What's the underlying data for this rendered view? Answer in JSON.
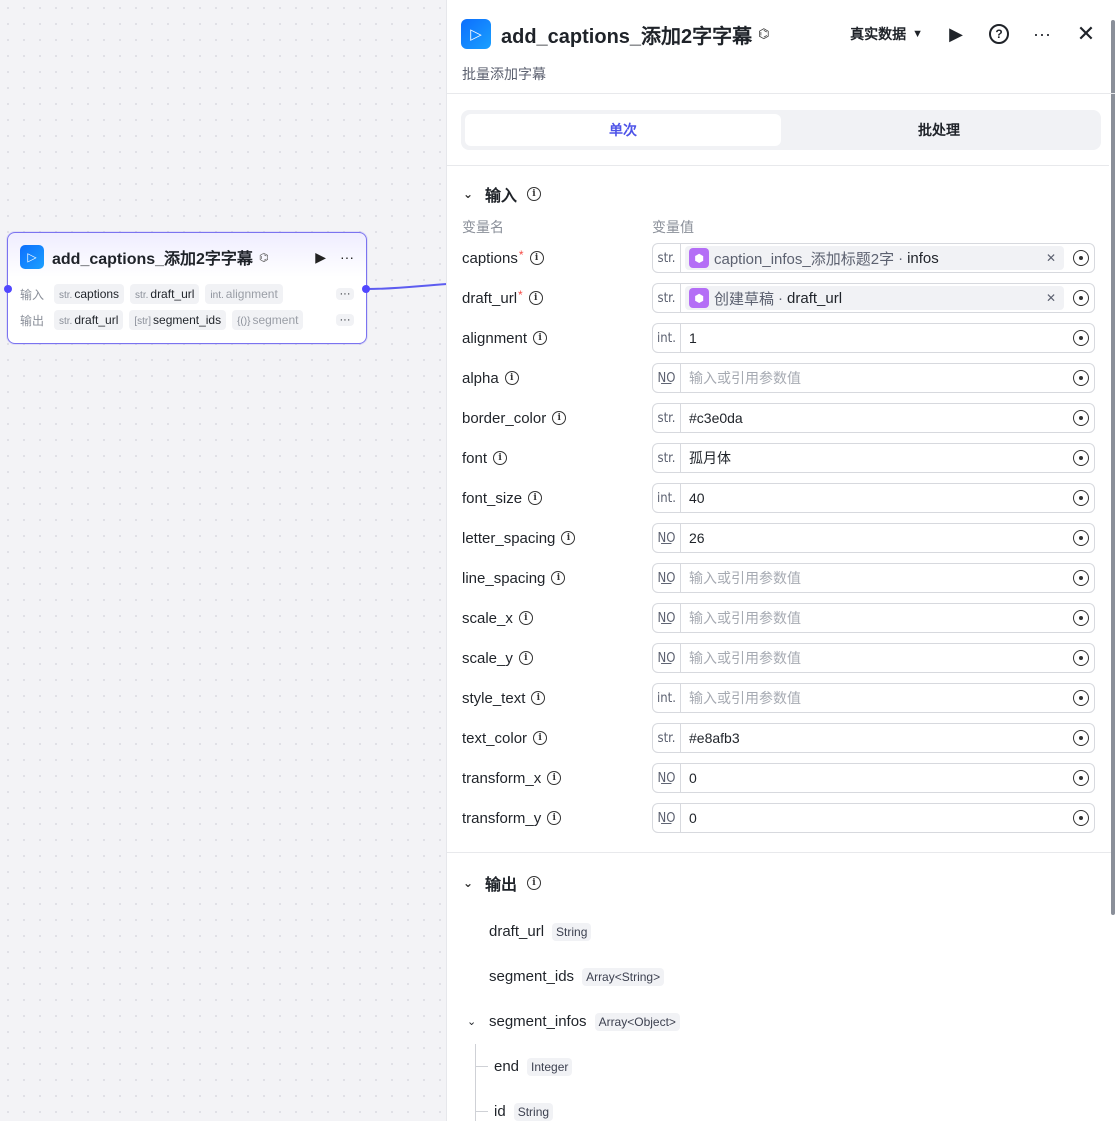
{
  "node": {
    "title": "add_captions_添加2字字幕",
    "input_label": "输入",
    "output_label": "输出",
    "inputs": [
      {
        "type": "str.",
        "name": "captions"
      },
      {
        "type": "str.",
        "name": "draft_url"
      },
      {
        "type": "int.",
        "name": "alignment"
      }
    ],
    "outputs": [
      {
        "type": "str.",
        "name": "draft_url"
      },
      {
        "type": "[str]",
        "name": "segment_ids"
      },
      {
        "type": "{()}",
        "name": "segment"
      }
    ],
    "more": "···"
  },
  "panel": {
    "title": "add_captions_添加2字字幕",
    "description": "批量添加字幕",
    "data_mode": "真实数据",
    "tabs": [
      "单次",
      "批处理"
    ],
    "input_section": "输入",
    "col_name": "变量名",
    "col_value": "变量值",
    "params": [
      {
        "name": "captions",
        "required": true,
        "type": "str.",
        "ref_source": "caption_infos_添加标题2字",
        "ref_field": "infos"
      },
      {
        "name": "draft_url",
        "required": true,
        "type": "str.",
        "ref_source": "创建草稿",
        "ref_field": "draft_url"
      },
      {
        "name": "alignment",
        "type": "int.",
        "value": "1"
      },
      {
        "name": "alpha",
        "type": "N͟O",
        "placeholder": "输入或引用参数值"
      },
      {
        "name": "border_color",
        "type": "str.",
        "value": "#c3e0da"
      },
      {
        "name": "font",
        "type": "str.",
        "value": "孤月体"
      },
      {
        "name": "font_size",
        "type": "int.",
        "value": "40"
      },
      {
        "name": "letter_spacing",
        "type": "N͟O",
        "value": "26"
      },
      {
        "name": "line_spacing",
        "type": "N͟O",
        "placeholder": "输入或引用参数值"
      },
      {
        "name": "scale_x",
        "type": "N͟O",
        "placeholder": "输入或引用参数值"
      },
      {
        "name": "scale_y",
        "type": "N͟O",
        "placeholder": "输入或引用参数值"
      },
      {
        "name": "style_text",
        "type": "int.",
        "placeholder": "输入或引用参数值"
      },
      {
        "name": "text_color",
        "type": "str.",
        "value": "#e8afb3"
      },
      {
        "name": "transform_x",
        "type": "N͟O",
        "value": "0"
      },
      {
        "name": "transform_y",
        "type": "N͟O",
        "value": "0"
      }
    ],
    "output_section": "输出",
    "outputs": [
      {
        "name": "draft_url",
        "type": "String"
      },
      {
        "name": "segment_ids",
        "type": "Array<String>"
      },
      {
        "name": "segment_infos",
        "type": "Array<Object>"
      }
    ],
    "segment_infos_children": [
      {
        "name": "end",
        "type": "Integer"
      },
      {
        "name": "id",
        "type": "String"
      }
    ]
  }
}
